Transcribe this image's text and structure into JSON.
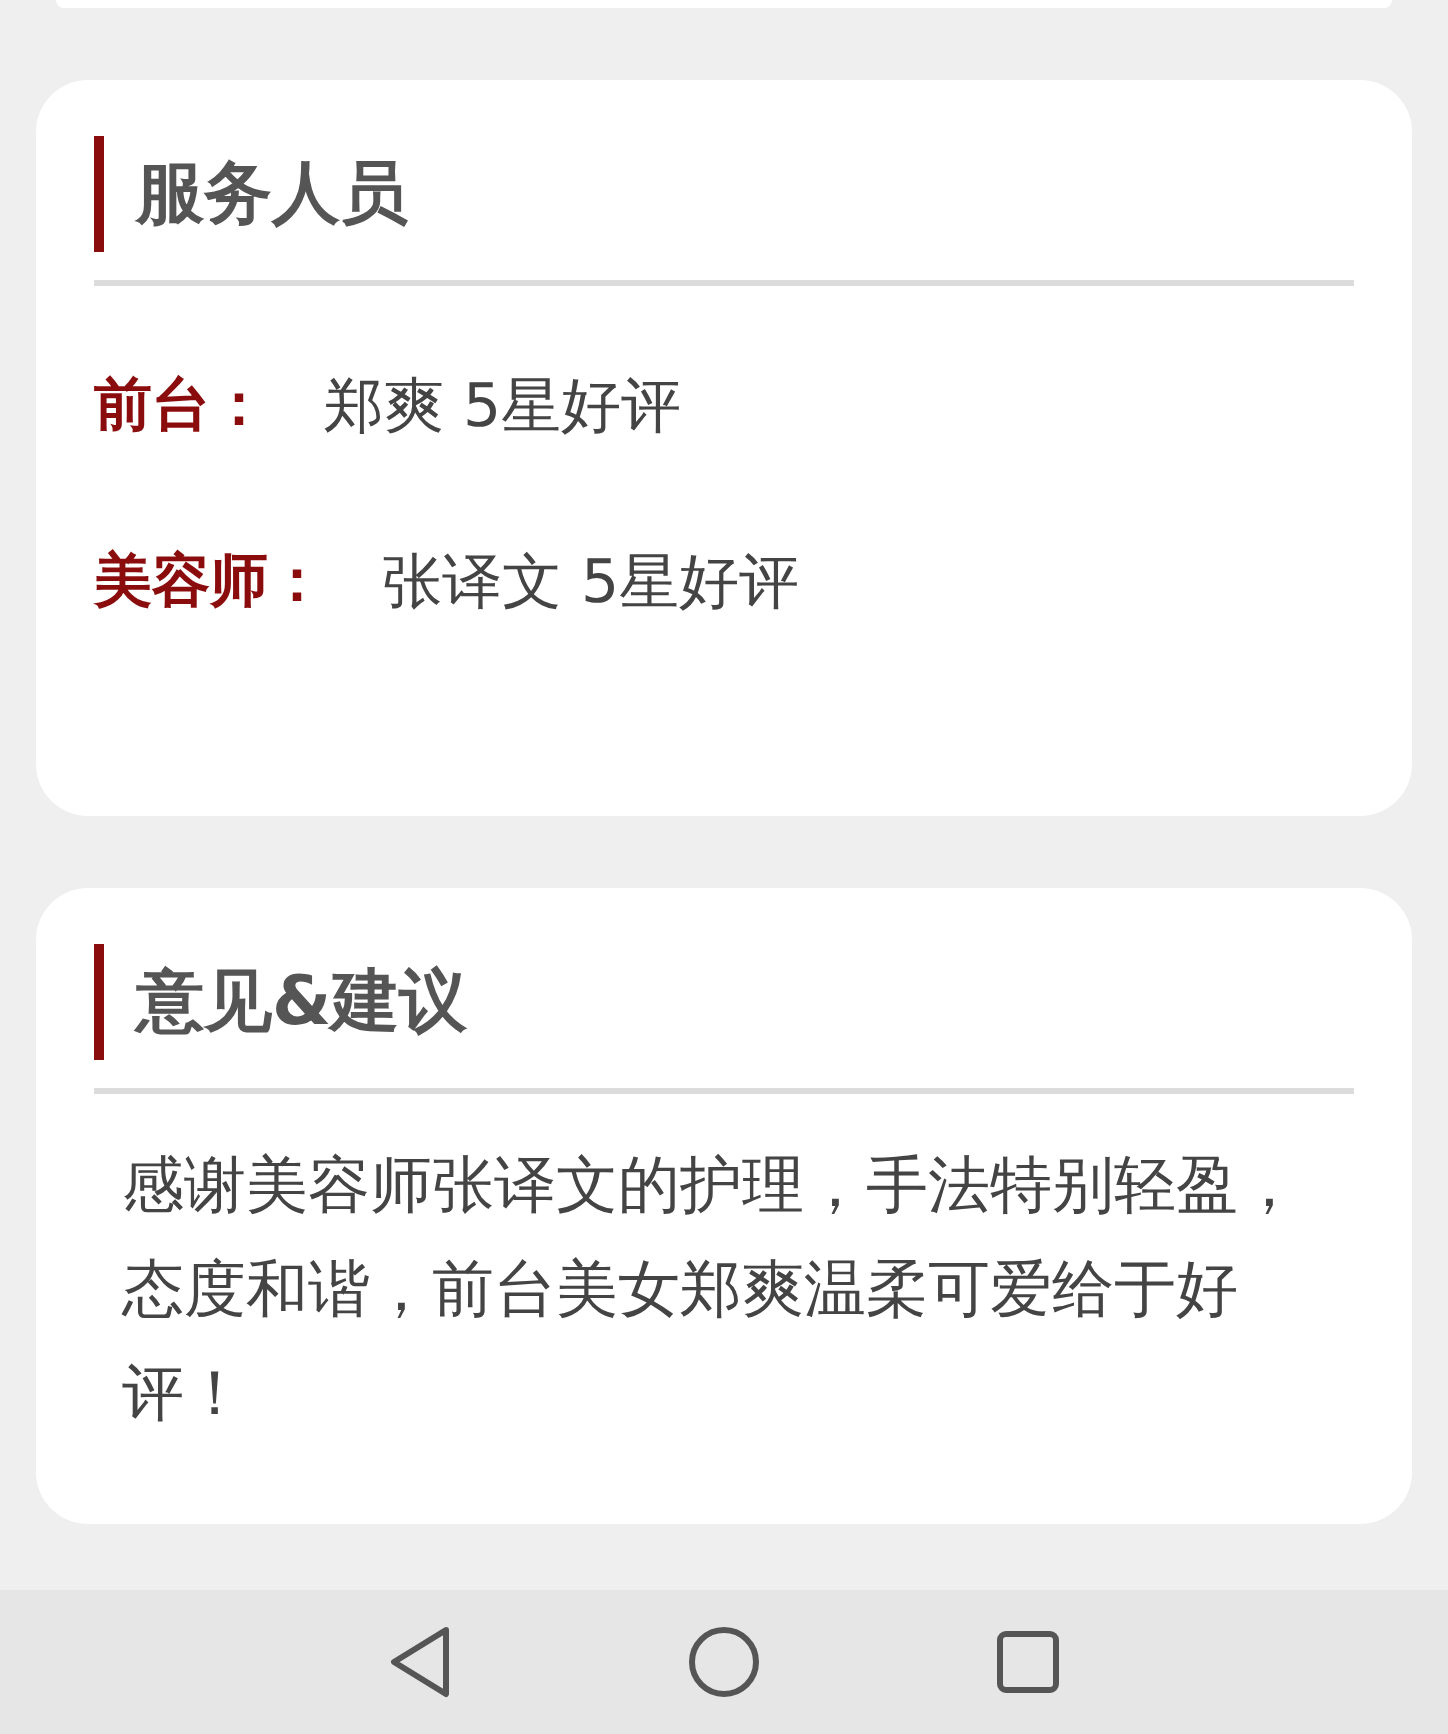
{
  "sections": [
    {
      "kind": "fields",
      "title": "服务人员",
      "rows": [
        {
          "label": "前台：",
          "value": "郑爽 5星好评"
        },
        {
          "label": "美容师：",
          "value": "张译文 5星好评"
        }
      ]
    },
    {
      "kind": "text",
      "title": "意见&建议",
      "text": "感谢美容师张译文的护理，手法特别轻盈，态度和谐，前台美女郑爽温柔可爱给于好评！"
    }
  ]
}
